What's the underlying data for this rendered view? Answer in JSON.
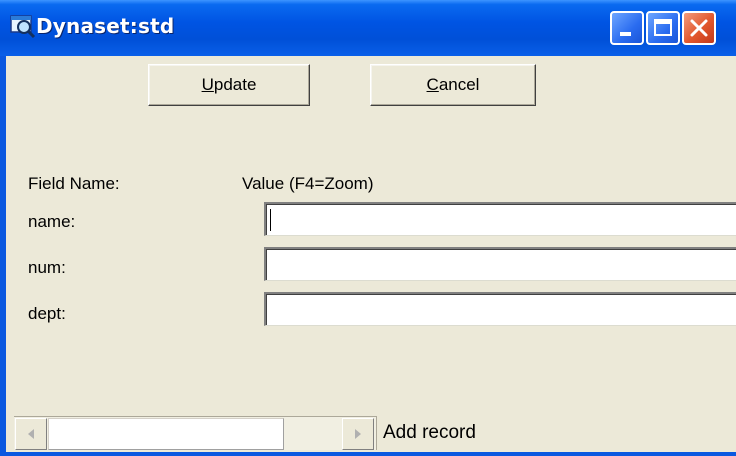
{
  "window": {
    "title": "Dynaset:std",
    "icon": "dynaset-search-icon",
    "controls": [
      "minimize-icon",
      "maximize-icon",
      "close-icon"
    ]
  },
  "toolbar": {
    "update_label_first": "U",
    "update_label_rest": "pdate",
    "cancel_label_first": "C",
    "cancel_label_rest": "ancel"
  },
  "form": {
    "header_field": "Field Name:",
    "header_value": "Value (F4=Zoom)",
    "fields": [
      {
        "label": "name:",
        "value": ""
      },
      {
        "label": "num:",
        "value": ""
      },
      {
        "label": "dept:",
        "value": ""
      }
    ]
  },
  "status": {
    "add_record": "Add record"
  },
  "colors": {
    "titlebar": "#0054e3",
    "window_bg": "#ece9d8",
    "close_button": "#e2572d"
  }
}
